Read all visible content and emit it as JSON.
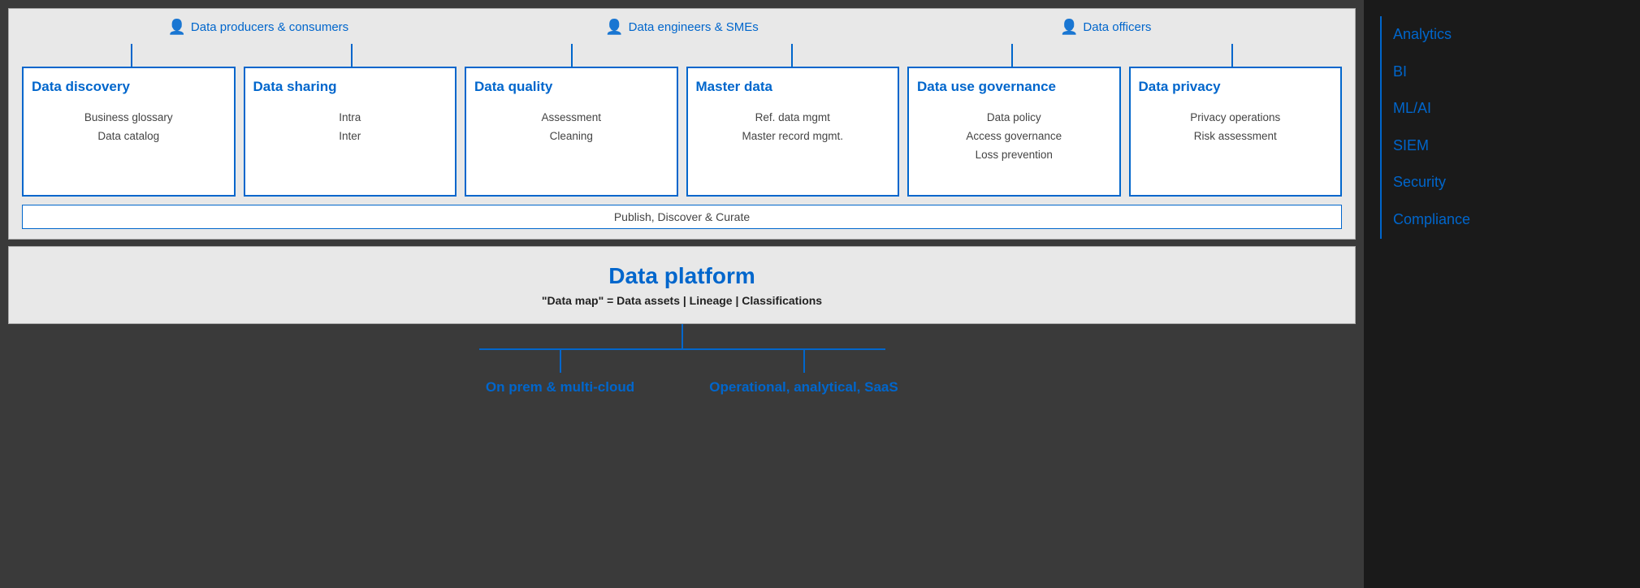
{
  "personas": [
    {
      "label": "Data producers & consumers"
    },
    {
      "label": "Data engineers & SMEs"
    },
    {
      "label": "Data officers"
    }
  ],
  "cards": [
    {
      "title": "Data discovery",
      "items": [
        "Business glossary",
        "Data catalog"
      ]
    },
    {
      "title": "Data sharing",
      "items": [
        "Intra",
        "Inter"
      ]
    },
    {
      "title": "Data quality",
      "items": [
        "Assessment",
        "Cleaning"
      ]
    },
    {
      "title": "Master data",
      "items": [
        "Ref. data mgmt",
        "Master record mgmt."
      ]
    },
    {
      "title": "Data use governance",
      "items": [
        "Data policy",
        "Access governance",
        "Loss prevention"
      ]
    },
    {
      "title": "Data privacy",
      "items": [
        "Privacy operations",
        "Risk assessment"
      ]
    }
  ],
  "publish_bar": "Publish, Discover & Curate",
  "platform": {
    "title": "Data platform",
    "subtitle": "\"Data map\" = Data assets | Lineage | Classifications"
  },
  "bottom_branches": {
    "left": "On prem & multi-cloud",
    "right": "Operational, analytical, SaaS"
  },
  "sidebar_items": [
    {
      "label": "Analytics"
    },
    {
      "label": "BI"
    },
    {
      "label": "ML/AI"
    },
    {
      "label": "SIEM"
    },
    {
      "label": "Security"
    },
    {
      "label": "Compliance"
    }
  ]
}
